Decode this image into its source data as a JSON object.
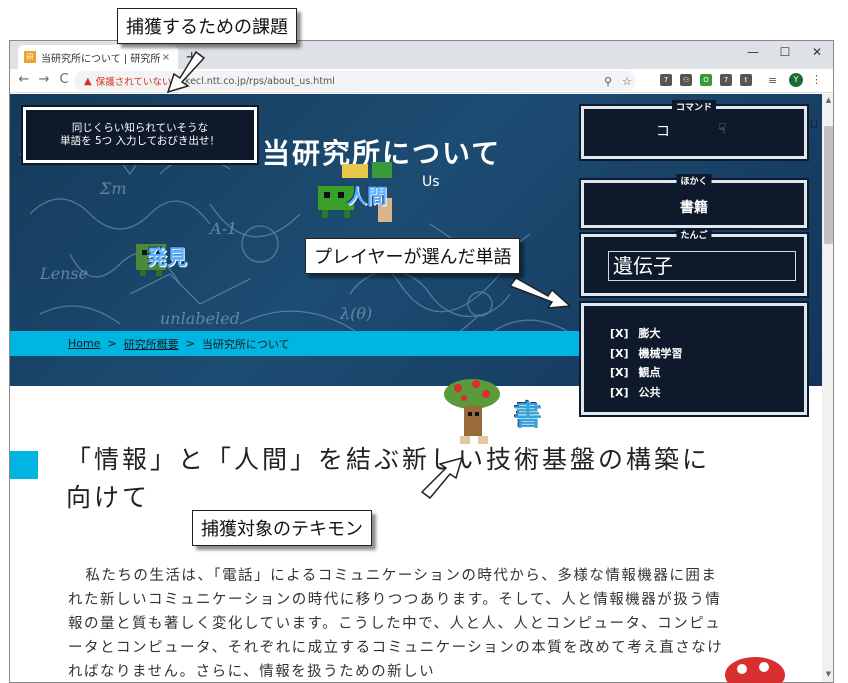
{
  "browser": {
    "tab_title": "当研究所について | 研究所概要 | N",
    "favicon_text": "研",
    "tab_close": "×",
    "new_tab": "+",
    "window_controls": [
      "—",
      "☐",
      "✕"
    ],
    "nav": {
      "back": "←",
      "forward": "→",
      "reload": "C"
    },
    "security_label": "保護されていない通",
    "url": "kecl.ntt.co.jp/rps/about_us.html",
    "extensions": [
      "7",
      "⚇",
      "O",
      "7",
      "t"
    ],
    "avatar_letter": "Y",
    "menu": "⋮"
  },
  "hero": {
    "title": "当研究所について",
    "subtitle": "Us",
    "right_edge_text": "U",
    "breadcrumb": {
      "home": "Home",
      "parent": "研究所概要",
      "current": "当研究所について",
      "separator": ">"
    }
  },
  "game": {
    "message_line1": "同じくらい知られていそうな",
    "message_line2": "単語を 5つ 入力しておびき出せ！",
    "command_panel": {
      "title": "コマンド",
      "button1": "コ",
      "button2": "☟"
    },
    "capture_panel": {
      "title": "ほかく",
      "label": "書籍"
    },
    "bait_panel": {
      "title": "たんご",
      "input_value": "遺伝子"
    },
    "word_list": [
      {
        "mark": "[X]",
        "word": "膨大"
      },
      {
        "mark": "[X]",
        "word": "機械学習"
      },
      {
        "mark": "[X]",
        "word": "観点"
      },
      {
        "mark": "[X]",
        "word": "公共"
      }
    ],
    "monster_labels": {
      "ningen": "人間",
      "hakken": "発見",
      "sho": "書"
    }
  },
  "content": {
    "heading": "「情報」と「人間」を結ぶ新しい技術基盤の構築に向けて",
    "paragraph": "私たちの生活は、「電話」によるコミュニケーションの時代から、多様な情報機器に囲まれた新しいコミュニケーションの時代に移りつつあります。そして、人と情報機器が扱う情報の量と質も著しく変化しています。こうした中で、人と人、人とコンピュータ、コンピュータとコンピュータ、それぞれに成立するコミュニケーションの本質を改めて考え直さなければなりません。さらに、情報を扱うための新しい"
  },
  "annotations": {
    "challenge": "捕獲するための課題",
    "player_word": "プレイヤーが選んだ単語",
    "target": "捕獲対象のテキモン"
  },
  "colors": {
    "accent": "#00b5e2",
    "panel_bg": "#0e1a2c",
    "hero_bg": "#1d4c72",
    "warning": "#d93025"
  }
}
